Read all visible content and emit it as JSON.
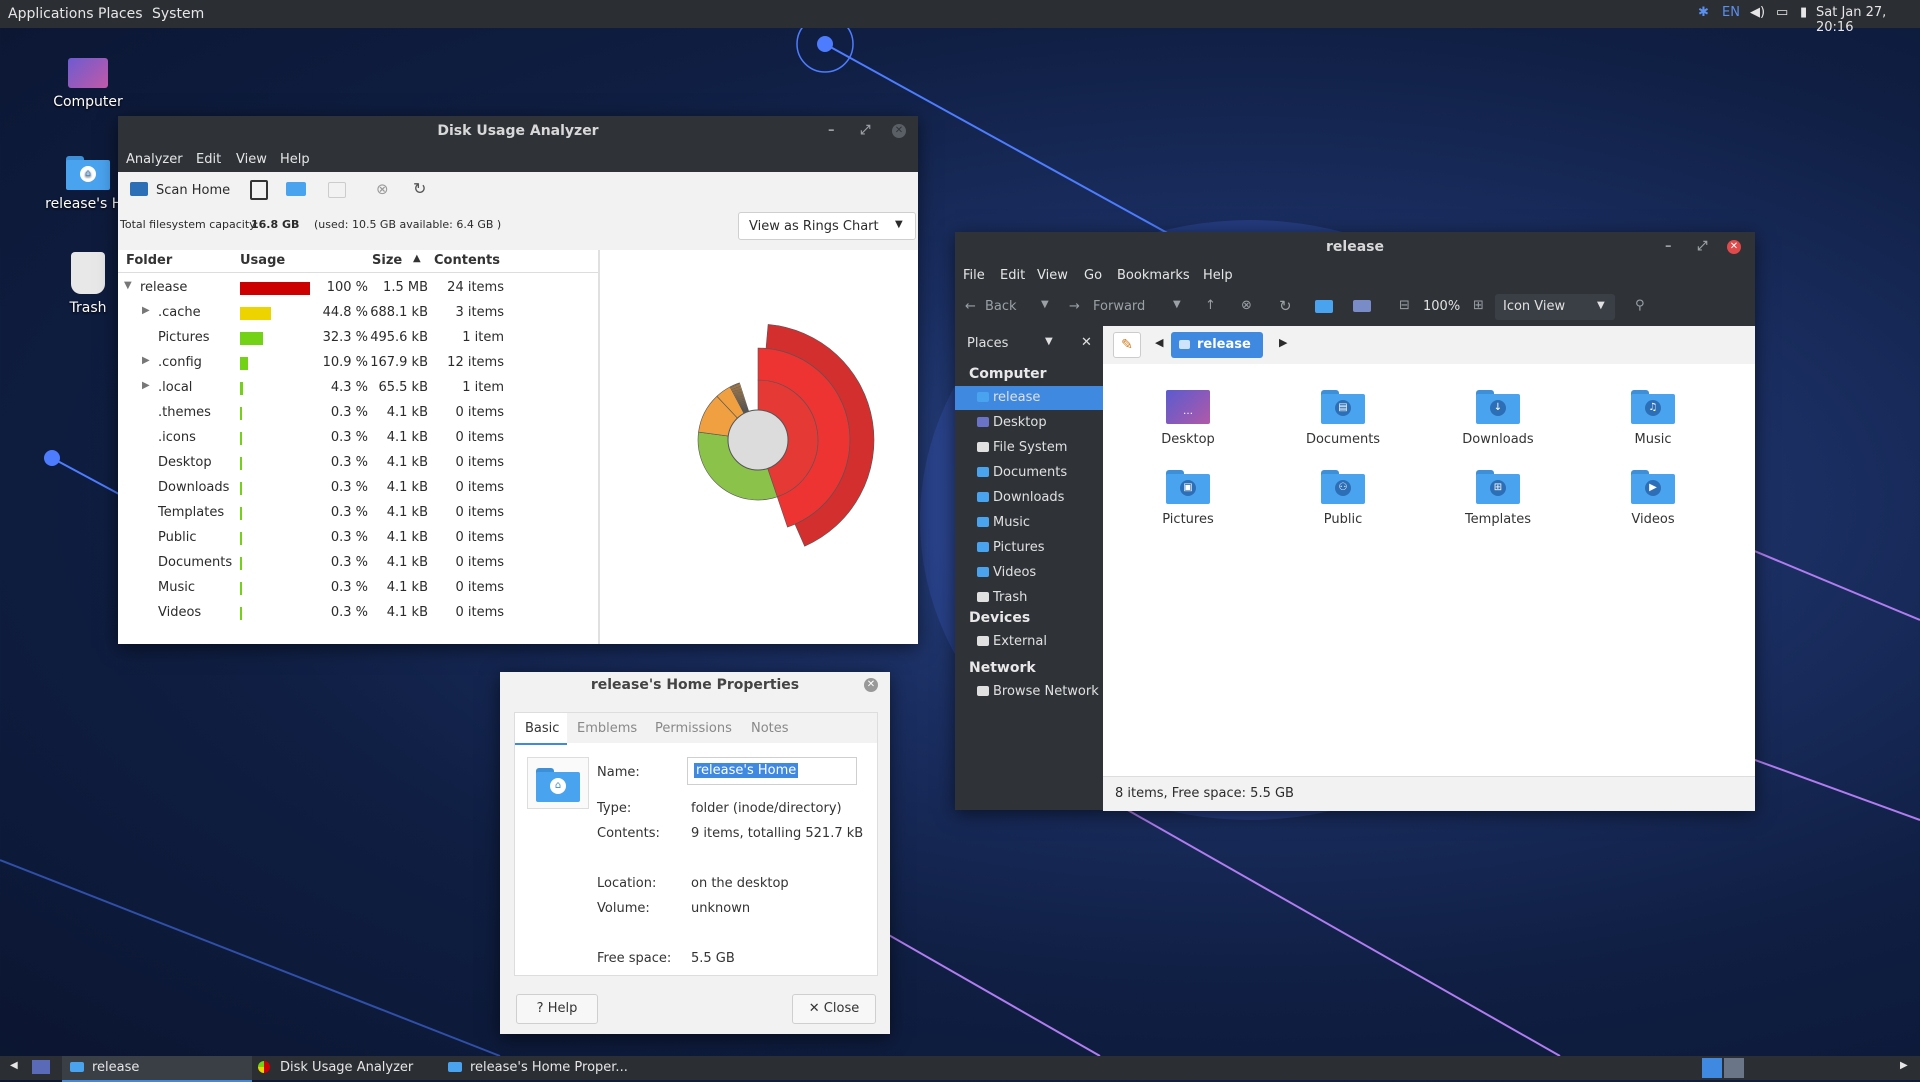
{
  "top_panel": {
    "menus": [
      "Applications",
      "Places",
      "System"
    ],
    "keyboard_layout": "EN",
    "clock": "Sat Jan 27, 20:16"
  },
  "desktop": {
    "icons": [
      {
        "label": "Computer"
      },
      {
        "label": "release's Ho"
      },
      {
        "label": "Trash"
      }
    ]
  },
  "dua": {
    "title": "Disk Usage Analyzer",
    "menus": [
      "Analyzer",
      "Edit",
      "View",
      "Help"
    ],
    "scan_home": "Scan Home",
    "capacity_prefix": "Total filesystem capacity:",
    "capacity_value": "16.8 GB",
    "capacity_suffix": "(used: 10.5 GB available: 6.4 GB )",
    "view_select": "View as Rings Chart",
    "columns": [
      "Folder",
      "Usage",
      "Size",
      "Contents"
    ],
    "rows": [
      {
        "name": "release",
        "percent": 100,
        "pct": "100 %",
        "size": "1.5 MB",
        "contents": "24 items",
        "color": "#cc0000",
        "expander": "open"
      },
      {
        "name": ".cache",
        "percent": 44.8,
        "pct": "44.8 %",
        "size": "688.1 kB",
        "contents": "3 items",
        "color": "#edd400",
        "expander": "closed"
      },
      {
        "name": "Pictures",
        "percent": 32.3,
        "pct": "32.3 %",
        "size": "495.6 kB",
        "contents": "1 item",
        "color": "#73d216",
        "expander": "none"
      },
      {
        "name": ".config",
        "percent": 10.9,
        "pct": "10.9 %",
        "size": "167.9 kB",
        "contents": "12 items",
        "color": "#73d216",
        "expander": "closed"
      },
      {
        "name": ".local",
        "percent": 4.3,
        "pct": "4.3 %",
        "size": "65.5 kB",
        "contents": "1 item",
        "color": "#73d216",
        "expander": "closed"
      },
      {
        "name": ".themes",
        "percent": 0.3,
        "pct": "0.3 %",
        "size": "4.1 kB",
        "contents": "0 items",
        "color": "#73d216",
        "expander": "none"
      },
      {
        "name": ".icons",
        "percent": 0.3,
        "pct": "0.3 %",
        "size": "4.1 kB",
        "contents": "0 items",
        "color": "#73d216",
        "expander": "none"
      },
      {
        "name": "Desktop",
        "percent": 0.3,
        "pct": "0.3 %",
        "size": "4.1 kB",
        "contents": "0 items",
        "color": "#73d216",
        "expander": "none"
      },
      {
        "name": "Downloads",
        "percent": 0.3,
        "pct": "0.3 %",
        "size": "4.1 kB",
        "contents": "0 items",
        "color": "#73d216",
        "expander": "none"
      },
      {
        "name": "Templates",
        "percent": 0.3,
        "pct": "0.3 %",
        "size": "4.1 kB",
        "contents": "0 items",
        "color": "#73d216",
        "expander": "none"
      },
      {
        "name": "Public",
        "percent": 0.3,
        "pct": "0.3 %",
        "size": "4.1 kB",
        "contents": "0 items",
        "color": "#73d216",
        "expander": "none"
      },
      {
        "name": "Documents",
        "percent": 0.3,
        "pct": "0.3 %",
        "size": "4.1 kB",
        "contents": "0 items",
        "color": "#73d216",
        "expander": "none"
      },
      {
        "name": "Music",
        "percent": 0.3,
        "pct": "0.3 %",
        "size": "4.1 kB",
        "contents": "0 items",
        "color": "#73d216",
        "expander": "none"
      },
      {
        "name": "Videos",
        "percent": 0.3,
        "pct": "0.3 %",
        "size": "4.1 kB",
        "contents": "0 items",
        "color": "#73d216",
        "expander": "none"
      }
    ]
  },
  "fm": {
    "title": "release",
    "menus": [
      "File",
      "Edit",
      "View",
      "Go",
      "Bookmarks",
      "Help"
    ],
    "back": "Back",
    "forward": "Forward",
    "zoom": "100%",
    "view_mode": "Icon View",
    "places_label": "Places",
    "path": "release",
    "sections": {
      "computer": "Computer",
      "devices": "Devices",
      "network": "Network"
    },
    "sidebar_computer": [
      {
        "label": "release",
        "icon": "home-icon",
        "selected": true
      },
      {
        "label": "Desktop",
        "icon": "desktop-icon"
      },
      {
        "label": "File System",
        "icon": "drive-icon"
      },
      {
        "label": "Documents",
        "icon": "folder-icon"
      },
      {
        "label": "Downloads",
        "icon": "folder-icon"
      },
      {
        "label": "Music",
        "icon": "folder-icon"
      },
      {
        "label": "Pictures",
        "icon": "folder-icon"
      },
      {
        "label": "Videos",
        "icon": "folder-icon"
      },
      {
        "label": "Trash",
        "icon": "trash-icon"
      }
    ],
    "sidebar_devices": [
      {
        "label": "External",
        "icon": "drive-icon"
      }
    ],
    "sidebar_network": [
      {
        "label": "Browse Network",
        "icon": "network-icon"
      }
    ],
    "items": [
      {
        "label": "Desktop",
        "symbol": "…"
      },
      {
        "label": "Documents",
        "symbol": "▤"
      },
      {
        "label": "Downloads",
        "symbol": "↓"
      },
      {
        "label": "Music",
        "symbol": "♫"
      },
      {
        "label": "Pictures",
        "symbol": "▣"
      },
      {
        "label": "Public",
        "symbol": "⚇"
      },
      {
        "label": "Templates",
        "symbol": "⊞"
      },
      {
        "label": "Videos",
        "symbol": "▶"
      }
    ],
    "status": "8 items, Free space: 5.5 GB"
  },
  "props": {
    "title": "release's Home Properties",
    "tabs": [
      "Basic",
      "Emblems",
      "Permissions",
      "Notes"
    ],
    "name_label": "Name:",
    "name_value": "release's Home",
    "type_label": "Type:",
    "type_value": "folder (inode/directory)",
    "contents_label": "Contents:",
    "contents_value": "9 items, totalling 521.7 kB",
    "location_label": "Location:",
    "location_value": "on the desktop",
    "volume_label": "Volume:",
    "volume_value": "unknown",
    "free_label": "Free space:",
    "free_value": "5.5 GB",
    "help_btn": "Help",
    "close_btn": "Close"
  },
  "taskbar": {
    "tasks": [
      {
        "label": "release",
        "active": true
      },
      {
        "label": "Disk Usage Analyzer"
      },
      {
        "label": "release's Home Proper..."
      }
    ]
  },
  "colors": {
    "accent": "#4aa3ef",
    "selected": "#3f8ae0",
    "panel": "#2b2e33"
  }
}
